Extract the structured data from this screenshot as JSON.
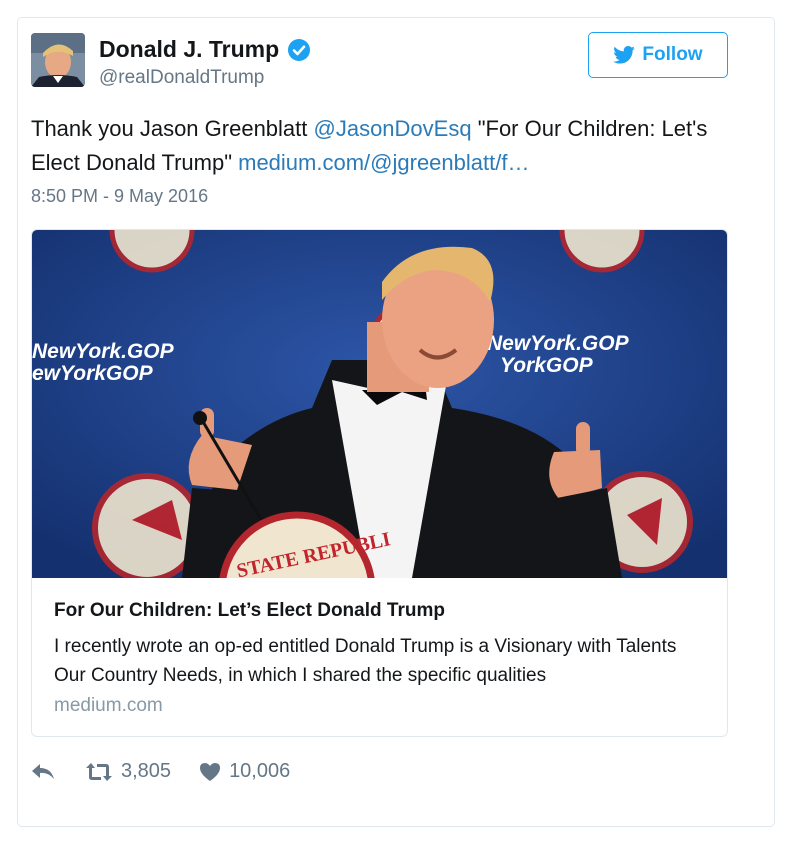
{
  "user": {
    "name": "Donald J. Trump",
    "handle": "@realDonaldTrump",
    "verified_color": "#1da1f2"
  },
  "follow_label": "Follow",
  "tweet": {
    "text_start": "Thank you Jason Greenblatt ",
    "mention": "@JasonDovEsq",
    "text_mid": " \"For Our Children: Let's Elect Donald Trump\" ",
    "link": "medium.com/@jgreenblatt/f…",
    "timestamp": "8:50 PM - 9 May 2016"
  },
  "card": {
    "title": "For Our Children: Let’s Elect Donald Trump",
    "description": "I recently wrote an op-ed entitled Donald Trump is a Visionary with Talents Our Country Needs, in which I shared the specific qualities",
    "domain": "medium.com",
    "backdrop_left_line1": "NewYork.GOP",
    "backdrop_left_line2": "ewYorkGOP",
    "backdrop_right_line1": "NewYork.GOP",
    "backdrop_right_line2": "YorkGOP",
    "podium_text": "STATE REPUBLI"
  },
  "stats": {
    "retweets": "3,805",
    "likes": "10,006"
  },
  "icons": {
    "reply": "reply-icon",
    "retweet": "retweet-icon",
    "like": "heart-icon",
    "bird": "twitter-bird-icon",
    "verified": "verified-badge-icon"
  },
  "colors": {
    "link": "#2b7bb9",
    "accent": "#1da1f2",
    "muted": "#657786",
    "backdrop": "#1f3f85"
  }
}
